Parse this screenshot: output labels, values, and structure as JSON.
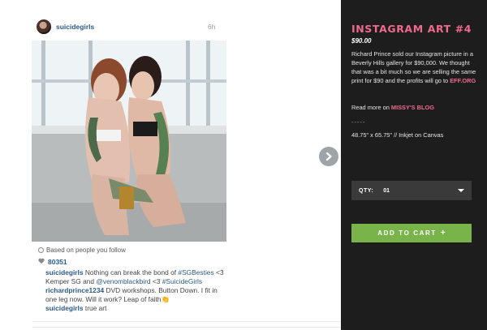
{
  "post": {
    "username": "suicidegirls",
    "timestamp": "6h",
    "based_on": "Based on people you follow",
    "likes": "80351",
    "comments": [
      {
        "user": "suicidegirls",
        "text": "Nothing can break the bond of",
        "tag1": "#SGBesties",
        "text2": "<3 Kemper SG and",
        "mention": "@venomblackbird",
        "text3": "<3",
        "tag2": "#SuicideGirls"
      },
      {
        "user": "richardprince1234",
        "text": "DVD workshops. Button Down. I fit in one leg now. Will it work? Leap of faith👏"
      },
      {
        "user": "suicidegirls",
        "text": "true art"
      }
    ],
    "icons": {
      "avatar": "avatar-image",
      "based_on_icon": "circle-icon",
      "likes_icon": "heart-icon",
      "next": "chevron-right-icon"
    }
  },
  "panel": {
    "title": "INSTAGRAM ART #4",
    "price": "$90.00",
    "description": "Richard Prince sold our Instagram picture in a Beverly Hills gallery for $90,000. We thought that was a bit much so we are selling the same print for $90 and the profits will go to",
    "description_link": "EFF.ORG",
    "read_more_prefix": "Read more on",
    "read_more_link": "MISSY'S BLOG",
    "divider": "-----",
    "dimensions": "48.75\" x 65.75\" // Inkjet on Canvas",
    "qty_label": "QTY:",
    "qty_value": "01",
    "add_to_cart": "ADD TO CART",
    "add_icon": "plus-icon"
  },
  "colors": {
    "accent_pink": "#f06a8e",
    "panel_bg": "#1d1d1d",
    "cart_green": "#78b44a",
    "link_blue": "#2b5a87"
  }
}
